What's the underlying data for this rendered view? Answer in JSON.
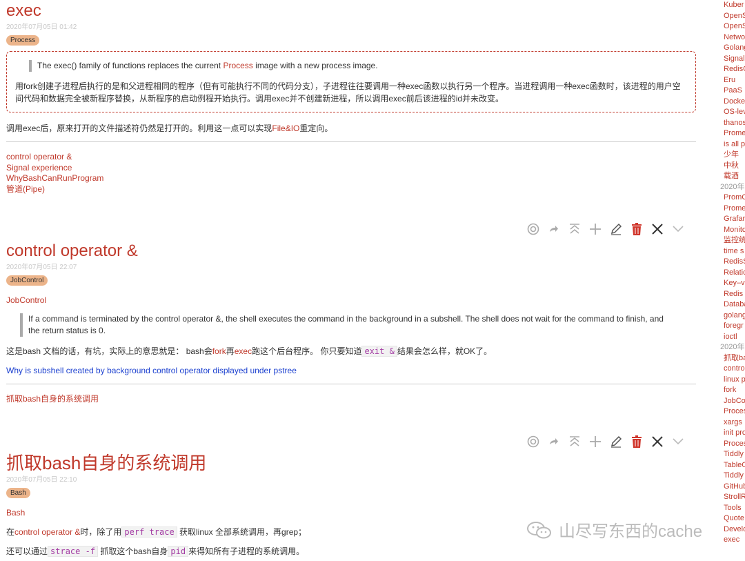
{
  "toolbar_icons": [
    "info-icon",
    "permalink-icon",
    "close-others-icon",
    "new-here-icon",
    "edit-icon",
    "delete-icon",
    "close-icon",
    "more-icon"
  ],
  "t1": {
    "title": "exec",
    "date": "2020年07月05日 01:42",
    "tag": "Process",
    "quote_pre": "The exec() family of functions replaces the current ",
    "quote_link": "Process",
    "quote_post": " image with a new process image.",
    "para1": "用fork创建子进程后执行的是和父进程相同的程序（但有可能执行不同的代码分支），子进程往往要调用一种exec函数以执行另一个程序。当进程调用一种exec函数时，该进程的用户空间代码和数据完全被新程序替换，从新程序的启动例程开始执行。调用exec并不创建新进程，所以调用exec前后该进程的id并未改变。",
    "para2_pre": "调用exec后，原来打开的文件描述符仍然是打开的。利用这一点可以实现",
    "para2_link": "File&IO",
    "para2_post": "重定向。",
    "links": [
      "control operator &",
      "Signal experience",
      "WhyBashCanRunProgram",
      "管道(Pipe)"
    ]
  },
  "t2": {
    "title": "control operator &",
    "date": "2020年07月05日 22:07",
    "tag": "JobControl",
    "tag_link": "JobControl",
    "quote": "If a command is terminated by the control operator &, the shell executes the command in the background in a subshell. The shell does not wait for the command to finish, and the return status is 0.",
    "p1_a": "这是bash 文档的话，有坑，实际上的意思就是：  bash会",
    "p1_fork": "fork",
    "p1_b": "再",
    "p1_exec": "exec",
    "p1_c": "跑这个后台程序。 你只要知道",
    "p1_code": "exit &",
    "p1_d": "结果会怎么样，就OK了。",
    "ext_link": "Why is subshell created by background control operator displayed under pstree",
    "backlink": "抓取bash自身的系统调用"
  },
  "t3": {
    "title": "抓取bash自身的系统调用",
    "date": "2020年07月05日 22:10",
    "tag": "Bash",
    "tag_link": "Bash",
    "p1_a": "在",
    "p1_link": "control operator &",
    "p1_b": "时，除了用",
    "p1_code": "perf trace",
    "p1_c": " 获取linux 全部系统调用，再grep；",
    "p2_a": "还可以通过",
    "p2_code1": "strace -f",
    "p2_b": " 抓取这个bash自身",
    "p2_code2": "pid",
    "p2_c": "来得知所有子进程的系统调用。"
  },
  "sidebar": [
    {
      "label": "Kuber",
      "kind": "red"
    },
    {
      "label": "OpenS",
      "kind": "red"
    },
    {
      "label": "OpenS",
      "kind": "red"
    },
    {
      "label": "Netwo",
      "kind": "red"
    },
    {
      "label": "Golang",
      "kind": "red"
    },
    {
      "label": "Signal",
      "kind": "red"
    },
    {
      "label": "RedisC",
      "kind": "red"
    },
    {
      "label": "Eru",
      "kind": "red"
    },
    {
      "label": "PaaS",
      "kind": "red"
    },
    {
      "label": "Docke",
      "kind": "red"
    },
    {
      "label": "OS-lev",
      "kind": "red"
    },
    {
      "label": "thanos",
      "kind": "red"
    },
    {
      "label": "Prome",
      "kind": "red"
    },
    {
      "label": "is all p",
      "kind": "red"
    },
    {
      "label": "少年",
      "kind": "red"
    },
    {
      "label": "中秋",
      "kind": "red"
    },
    {
      "label": "载酒",
      "kind": "red"
    },
    {
      "label": "2020年",
      "kind": "gray"
    },
    {
      "label": "PromC",
      "kind": "red"
    },
    {
      "label": "Prome",
      "kind": "red"
    },
    {
      "label": "Grafar",
      "kind": "red"
    },
    {
      "label": "Monito",
      "kind": "red"
    },
    {
      "label": "监控统",
      "kind": "red"
    },
    {
      "label": "time s",
      "kind": "red"
    },
    {
      "label": "RedisS",
      "kind": "red"
    },
    {
      "label": "Relatio",
      "kind": "red"
    },
    {
      "label": "Key–va",
      "kind": "red"
    },
    {
      "label": "Redis",
      "kind": "red"
    },
    {
      "label": "Databa",
      "kind": "red"
    },
    {
      "label": "golang",
      "kind": "red"
    },
    {
      "label": "foregr",
      "kind": "red"
    },
    {
      "label": "ioctl",
      "kind": "red"
    },
    {
      "label": "2020年",
      "kind": "gray"
    },
    {
      "label": "抓取ba",
      "kind": "red"
    },
    {
      "label": "contro",
      "kind": "red"
    },
    {
      "label": "linux p",
      "kind": "red"
    },
    {
      "label": "fork",
      "kind": "red"
    },
    {
      "label": "JobCo",
      "kind": "red"
    },
    {
      "label": "Proces",
      "kind": "red"
    },
    {
      "label": "xargs",
      "kind": "red"
    },
    {
      "label": "init pro",
      "kind": "red"
    },
    {
      "label": "Proces",
      "kind": "red"
    },
    {
      "label": "Tiddly",
      "kind": "red"
    },
    {
      "label": "TableO",
      "kind": "red"
    },
    {
      "label": "Tiddly",
      "kind": "red"
    },
    {
      "label": "GitHub",
      "kind": "red"
    },
    {
      "label": "StrollR",
      "kind": "red"
    },
    {
      "label": "Tools",
      "kind": "red"
    },
    {
      "label": "Quote",
      "kind": "red"
    },
    {
      "label": "Develo",
      "kind": "red"
    },
    {
      "label": "exec",
      "kind": "red"
    }
  ],
  "watermark": "山尽写东西的cache"
}
